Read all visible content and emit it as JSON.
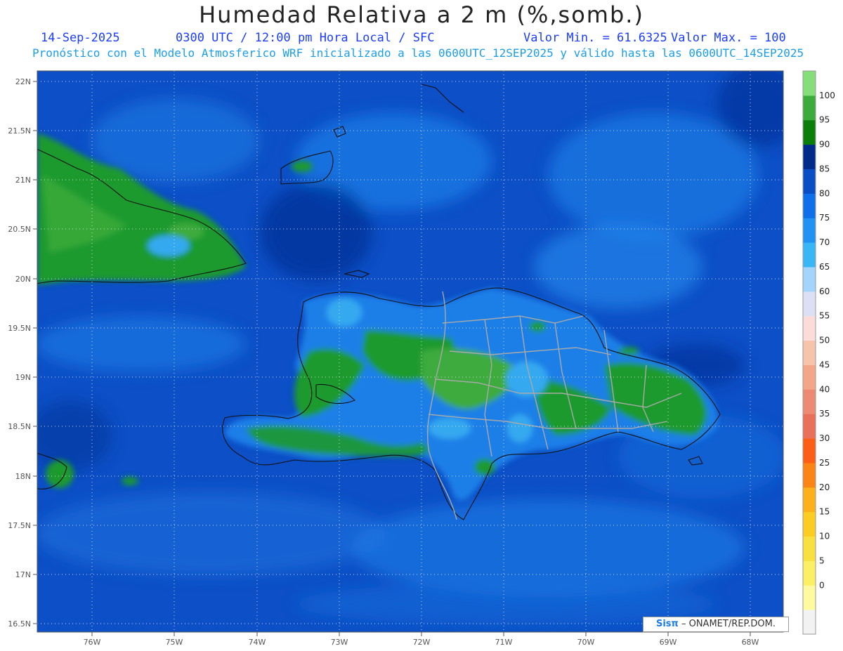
{
  "header": {
    "title": "Humedad Relativa a 2 m (%,somb.)",
    "date": "14-Sep-2025",
    "time": "0300 UTC / 12:00 pm Hora Local / SFC",
    "min_label": "Valor Min. = 61.6325",
    "max_label": "Valor Max. = 100",
    "model_info": "Pronóstico con el Modelo Atmosferico WRF inicializado a las 0600UTC_12SEP2025 y válido hasta las  0600UTC_14SEP2025"
  },
  "axes": {
    "lat_labels": [
      "22N",
      "21.5N",
      "21N",
      "20.5N",
      "20N",
      "19.5N",
      "19N",
      "18.5N",
      "18N",
      "17.5N",
      "17N",
      "16.5N"
    ],
    "lon_labels": [
      "76W",
      "75W",
      "74W",
      "73W",
      "72W",
      "71W",
      "70W",
      "69W",
      "68W"
    ]
  },
  "colorbar": {
    "labels": [
      "0",
      "5",
      "10",
      "15",
      "20",
      "25",
      "30",
      "35",
      "40",
      "45",
      "50",
      "55",
      "60",
      "65",
      "70",
      "75",
      "80",
      "85",
      "90",
      "95",
      "100"
    ],
    "colors": [
      "#f2f2f2",
      "#fff9a0",
      "#fbf065",
      "#f7e040",
      "#fbcc22",
      "#fcb11a",
      "#fa8414",
      "#fb5e14",
      "#e9705a",
      "#ed8a73",
      "#f2a888",
      "#f6c4aa",
      "#fbdcd8",
      "#dde0f5",
      "#a3d4fb",
      "#38b6f6",
      "#1f92f2",
      "#0f6fe8",
      "#0a4ec5",
      "#002a8a",
      "#0a7d0a",
      "#3cab3c",
      "#86de7a"
    ]
  },
  "credit": {
    "brand": "Sisπ",
    "org": "– ONAMET/REP.DOM."
  },
  "colors": {
    "ocean": "#0c4fc6",
    "ocean_light": "#1f7fe8",
    "land_green": "#1e9a2e",
    "land_light": "#35a9f0",
    "title_blue": "#1c3cff",
    "info_cyan": "#1c9ee6"
  }
}
